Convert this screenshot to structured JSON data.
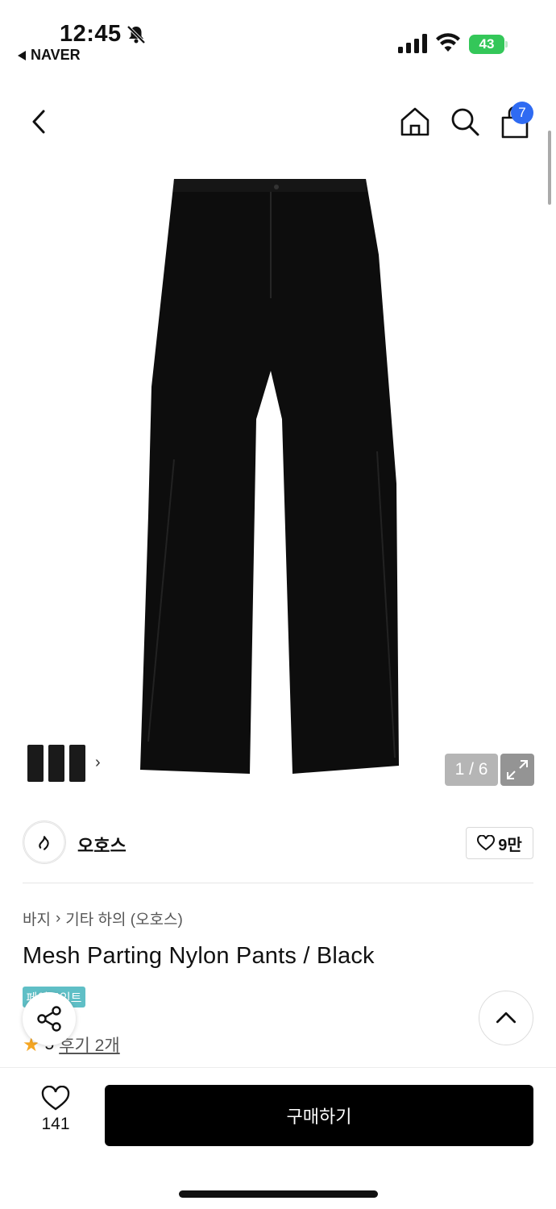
{
  "status": {
    "time": "12:45",
    "back_app": "NAVER",
    "battery": "43"
  },
  "header": {
    "cart_count": "7"
  },
  "gallery": {
    "counter": "1 / 6"
  },
  "store": {
    "name": "오호스",
    "likes": "9만"
  },
  "product": {
    "breadcrumb": [
      "바지",
      "기타 하의 (오호스)"
    ],
    "title": "Mesh Parting Nylon Pants / Black",
    "badge": "페이포인트",
    "rating_value": "5",
    "review_label": "후기 2개"
  },
  "bottom": {
    "wish_count": "141",
    "buy_label": "구매하기"
  },
  "colors": {
    "accent_badge": "#2f6bf2",
    "pay_badge": "#5fbfc6",
    "buy": "#000000"
  }
}
